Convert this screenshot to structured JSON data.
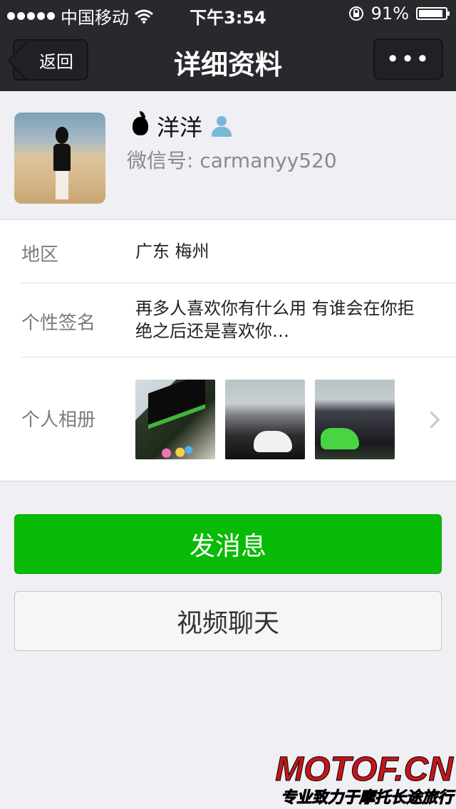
{
  "status_bar": {
    "carrier": "中国移动",
    "time": "下午3:54",
    "battery": "91%",
    "battery_level": 0.91,
    "icons": [
      "signal-dots",
      "wifi-icon",
      "rotation-lock-icon",
      "battery-icon"
    ]
  },
  "nav": {
    "back_label": "返回",
    "title": "详细资料",
    "more_label": "•••"
  },
  "profile": {
    "name": "洋洋",
    "wechat_label": "微信号:",
    "wechat_id": "carmanyy520"
  },
  "info": {
    "region_label": "地区",
    "region_value": "广东  梅州",
    "signature_label": "个性签名",
    "signature_value": "再多人喜欢你有什么用 有谁会在你拒绝之后还是喜欢你…",
    "album_label": "个人相册"
  },
  "actions": {
    "send_message": "发消息",
    "video_chat": "视频聊天"
  },
  "watermark": {
    "title": "MOTOF.CN",
    "subtitle": "专业致力于摩托长途旅行"
  },
  "colors": {
    "nav_bg": "#27292d",
    "page_bg": "#efeff4",
    "primary_green": "#09bb07",
    "label_gray": "#7b7b7b",
    "watermark_red": "#c61519"
  }
}
